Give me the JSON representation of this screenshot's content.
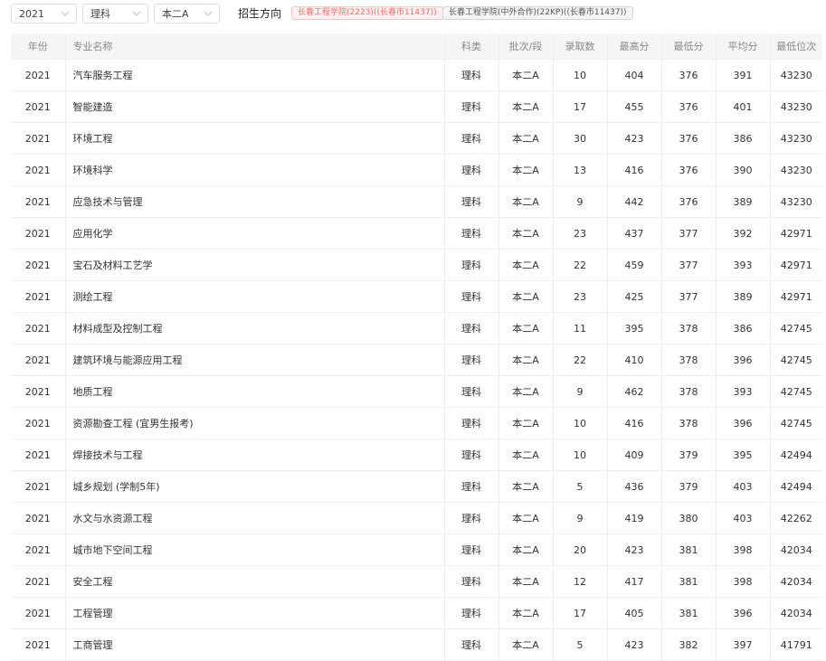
{
  "filters": {
    "year": "2021",
    "subject": "理科",
    "batch": "本二A",
    "direction_label": "招生方向",
    "tags": [
      {
        "label": "长春工程学院(2223)((长春市11437))",
        "active": true
      },
      {
        "label": "长春工程学院(中外合作)(22KP)((长春市11437))",
        "active": false
      }
    ]
  },
  "table": {
    "headers": [
      "年份",
      "专业名称",
      "科类",
      "批次/段",
      "录取数",
      "最高分",
      "最低分",
      "平均分",
      "最低位次"
    ],
    "rows": [
      [
        "2021",
        "汽车服务工程",
        "理科",
        "本二A",
        "10",
        "404",
        "376",
        "391",
        "43230"
      ],
      [
        "2021",
        "智能建造",
        "理科",
        "本二A",
        "17",
        "455",
        "376",
        "401",
        "43230"
      ],
      [
        "2021",
        "环境工程",
        "理科",
        "本二A",
        "30",
        "423",
        "376",
        "386",
        "43230"
      ],
      [
        "2021",
        "环境科学",
        "理科",
        "本二A",
        "13",
        "416",
        "376",
        "390",
        "43230"
      ],
      [
        "2021",
        "应急技术与管理",
        "理科",
        "本二A",
        "9",
        "442",
        "376",
        "389",
        "43230"
      ],
      [
        "2021",
        "应用化学",
        "理科",
        "本二A",
        "23",
        "437",
        "377",
        "392",
        "42971"
      ],
      [
        "2021",
        "宝石及材料工艺学",
        "理科",
        "本二A",
        "22",
        "459",
        "377",
        "393",
        "42971"
      ],
      [
        "2021",
        "测绘工程",
        "理科",
        "本二A",
        "23",
        "425",
        "377",
        "389",
        "42971"
      ],
      [
        "2021",
        "材料成型及控制工程",
        "理科",
        "本二A",
        "11",
        "395",
        "378",
        "386",
        "42745"
      ],
      [
        "2021",
        "建筑环境与能源应用工程",
        "理科",
        "本二A",
        "22",
        "410",
        "378",
        "396",
        "42745"
      ],
      [
        "2021",
        "地质工程",
        "理科",
        "本二A",
        "9",
        "462",
        "378",
        "393",
        "42745"
      ],
      [
        "2021",
        "资源勘查工程 (宜男生报考)",
        "理科",
        "本二A",
        "10",
        "416",
        "378",
        "396",
        "42745"
      ],
      [
        "2021",
        "焊接技术与工程",
        "理科",
        "本二A",
        "10",
        "409",
        "379",
        "395",
        "42494"
      ],
      [
        "2021",
        "城乡规划 (学制5年)",
        "理科",
        "本二A",
        "5",
        "436",
        "379",
        "403",
        "42494"
      ],
      [
        "2021",
        "水文与水资源工程",
        "理科",
        "本二A",
        "9",
        "419",
        "380",
        "403",
        "42262"
      ],
      [
        "2021",
        "城市地下空间工程",
        "理科",
        "本二A",
        "20",
        "423",
        "381",
        "398",
        "42034"
      ],
      [
        "2021",
        "安全工程",
        "理科",
        "本二A",
        "12",
        "417",
        "381",
        "398",
        "42034"
      ],
      [
        "2021",
        "工程管理",
        "理科",
        "本二A",
        "17",
        "405",
        "381",
        "396",
        "42034"
      ],
      [
        "2021",
        "工商管理",
        "理科",
        "本二A",
        "5",
        "423",
        "382",
        "397",
        "41791"
      ]
    ]
  },
  "icons": {
    "dropdown": "chevron-down-icon"
  }
}
